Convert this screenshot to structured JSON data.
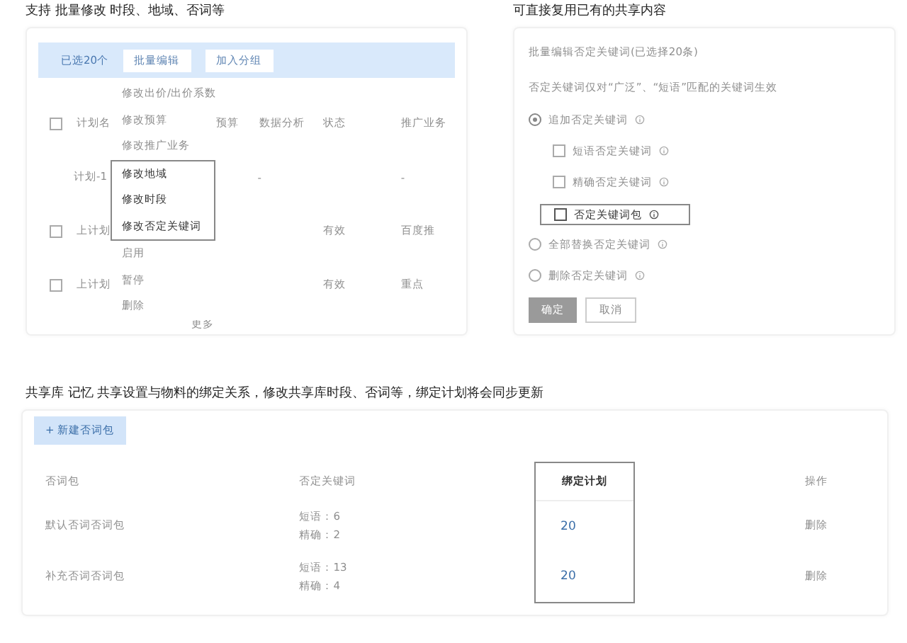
{
  "left": {
    "caption": "支持 批量修改 时段、地域、否词等",
    "toolbar": {
      "selection": "已选20个",
      "edit_button": "批量编辑",
      "group_button": "加入分组"
    },
    "table": {
      "all_checked": false,
      "columns": [
        "计划名",
        "预算",
        "数据分析",
        "状态",
        "推广业务"
      ],
      "rows": [
        {
          "cells": [
            "计划-1",
            "",
            "-",
            "",
            "-"
          ]
        },
        {
          "checked": false,
          "cells": [
            "上计划",
            "",
            "",
            "有效",
            "百度推"
          ]
        },
        {
          "checked": false,
          "cells": [
            "上计划",
            "",
            "",
            "有效",
            "重点"
          ]
        }
      ],
      "footer": "更多"
    },
    "menu": [
      {
        "label": "修改出价/出价系数",
        "highlighted": false
      },
      {
        "label": "修改预算",
        "highlighted": false
      },
      {
        "label": "修改推广业务",
        "highlighted": false
      },
      {
        "label": "修改地域",
        "highlighted": true
      },
      {
        "label": "修改时段",
        "highlighted": true
      },
      {
        "label": "修改否定关键词",
        "highlighted": true
      },
      {
        "label": "启用",
        "highlighted": false
      },
      {
        "label": "暂停",
        "highlighted": false
      },
      {
        "label": "删除",
        "highlighted": false
      }
    ]
  },
  "right": {
    "caption": "可直接复用已有的共享内容",
    "dialog_title": "批量编辑否定关键词(已选择20条)",
    "note": "否定关键词仅对“广泛”、“短语”匹配的关键词生效",
    "options": [
      {
        "kind": "radio",
        "label": "追加否定关键词",
        "selected": true,
        "highlighted": false,
        "info": true,
        "children": [
          {
            "kind": "checkbox",
            "label": "短语否定关键词",
            "checked": false,
            "highlighted": false,
            "info": true
          },
          {
            "kind": "checkbox",
            "label": "精确否定关键词",
            "checked": false,
            "highlighted": false,
            "info": true
          },
          {
            "kind": "checkbox",
            "label": "否定关键词包",
            "checked": false,
            "highlighted": true,
            "info": true
          }
        ]
      },
      {
        "kind": "radio",
        "label": "全部替换否定关键词",
        "selected": false,
        "highlighted": false,
        "info": true
      },
      {
        "kind": "radio",
        "label": "删除否定关键词",
        "selected": false,
        "highlighted": false,
        "info": true
      }
    ],
    "buttons": [
      {
        "label": "确定",
        "kind": "primary"
      },
      {
        "label": "取消",
        "kind": "plain"
      }
    ]
  },
  "bottom": {
    "caption": "共享库 记忆 共享设置与物料的绑定关系，修改共享库时段、否词等，绑定计划将会同步更新",
    "new_button": "+ 新建否词包",
    "columns": [
      {
        "label": "否词包",
        "highlighted": false
      },
      {
        "label": "否定关键词",
        "highlighted": false
      },
      {
        "label": "绑定计划",
        "highlighted": true
      },
      {
        "label": "操作",
        "highlighted": false
      }
    ],
    "rows": [
      {
        "name": "默认否词否词包",
        "keywords": [
          "短语：6",
          "精确：2"
        ],
        "plans": "20",
        "action": "删除"
      },
      {
        "name": "补充否词否词包",
        "keywords": [
          "短语：13",
          "精确：4"
        ],
        "plans": "20",
        "action": "删除"
      }
    ]
  }
}
